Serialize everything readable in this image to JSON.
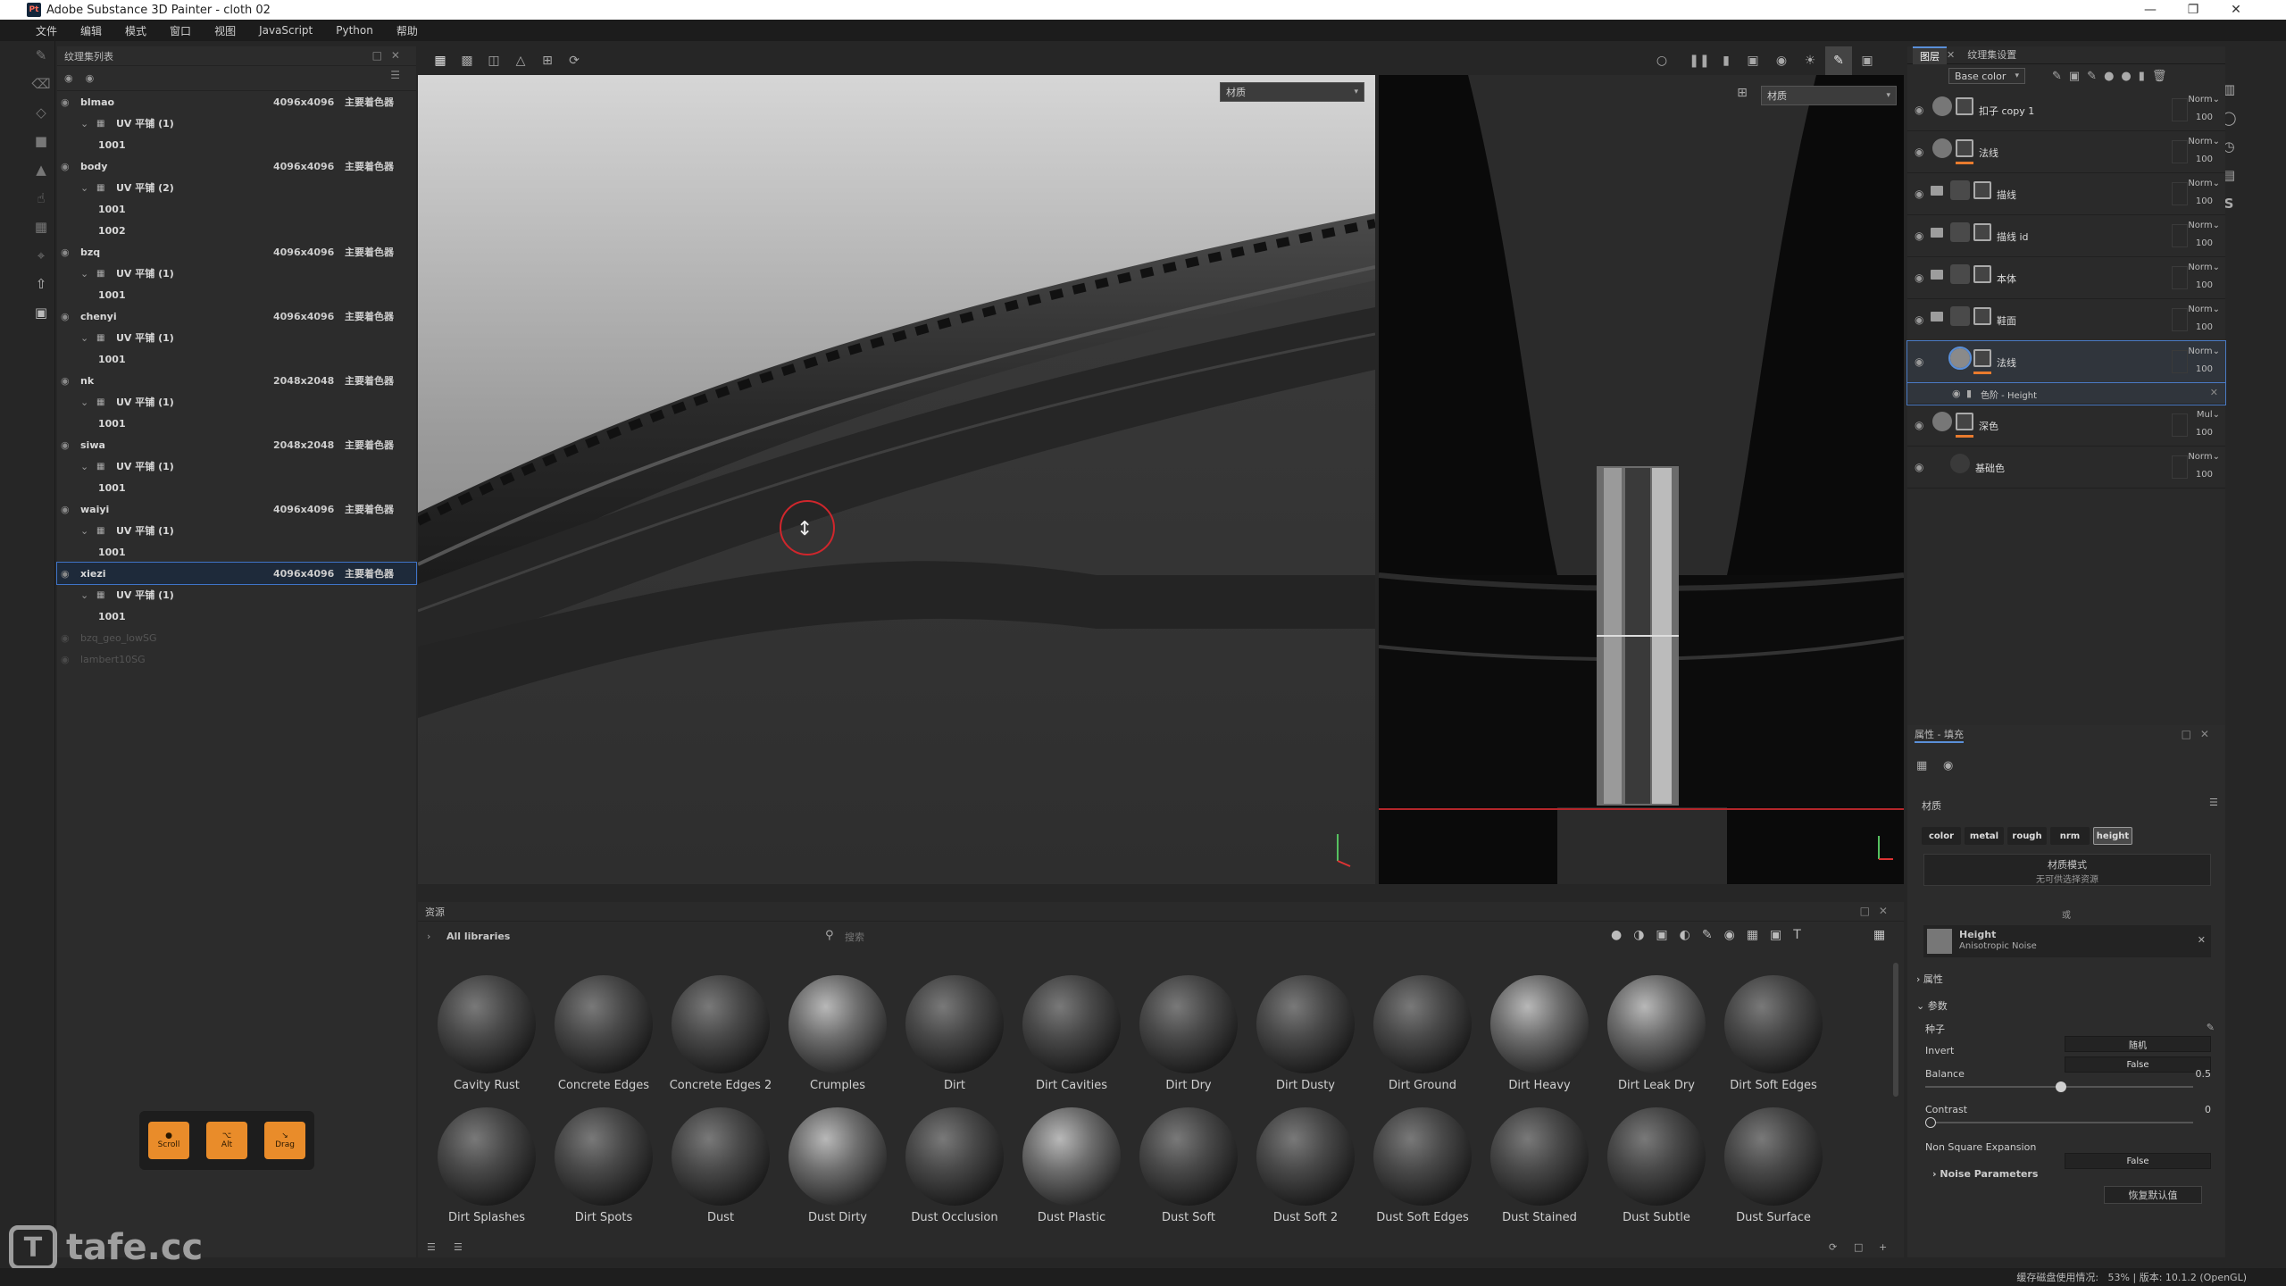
{
  "window": {
    "title": "Adobe Substance 3D Painter - cloth 02",
    "logo": "Pt"
  },
  "menu": [
    "文件",
    "编辑",
    "模式",
    "窗口",
    "视图",
    "JavaScript",
    "Python",
    "帮助"
  ],
  "texture_sets": {
    "title": "纹理集列表",
    "rows": [
      {
        "kind": "top",
        "name": "blmao",
        "size": "4096x4096",
        "shader": "主要着色器"
      },
      {
        "kind": "uv",
        "name": "UV 平铺 (1)"
      },
      {
        "kind": "tile",
        "name": "1001"
      },
      {
        "kind": "top",
        "name": "body",
        "size": "4096x4096",
        "shader": "主要着色器"
      },
      {
        "kind": "uv",
        "name": "UV 平铺 (2)"
      },
      {
        "kind": "tile",
        "name": "1001"
      },
      {
        "kind": "tile",
        "name": "1002"
      },
      {
        "kind": "top",
        "name": "bzq",
        "size": "4096x4096",
        "shader": "主要着色器"
      },
      {
        "kind": "uv",
        "name": "UV 平铺 (1)"
      },
      {
        "kind": "tile",
        "name": "1001"
      },
      {
        "kind": "top",
        "name": "chenyi",
        "size": "4096x4096",
        "shader": "主要着色器"
      },
      {
        "kind": "uv",
        "name": "UV 平铺 (1)"
      },
      {
        "kind": "tile",
        "name": "1001"
      },
      {
        "kind": "top",
        "name": "nk",
        "size": "2048x2048",
        "shader": "主要着色器"
      },
      {
        "kind": "uv",
        "name": "UV 平铺 (1)"
      },
      {
        "kind": "tile",
        "name": "1001"
      },
      {
        "kind": "top",
        "name": "siwa",
        "size": "2048x2048",
        "shader": "主要着色器"
      },
      {
        "kind": "uv",
        "name": "UV 平铺 (1)"
      },
      {
        "kind": "tile",
        "name": "1001"
      },
      {
        "kind": "top",
        "name": "waiyi",
        "size": "4096x4096",
        "shader": "主要着色器"
      },
      {
        "kind": "uv",
        "name": "UV 平铺 (1)"
      },
      {
        "kind": "tile",
        "name": "1001"
      },
      {
        "kind": "top",
        "name": "xiezi",
        "size": "4096x4096",
        "shader": "主要着色器",
        "selected": true
      },
      {
        "kind": "uv",
        "name": "UV 平铺 (1)"
      },
      {
        "kind": "tile",
        "name": "1001"
      },
      {
        "kind": "dim",
        "name": "bzq_geo_lowSG"
      },
      {
        "kind": "dim",
        "name": "lambert10SG"
      }
    ]
  },
  "viewport": {
    "dropdown3d": "材质",
    "dropdown2d": "材质"
  },
  "layers_panel": {
    "tabs": [
      "图层",
      "纹理集设置"
    ],
    "channel": "Base color",
    "layers": [
      {
        "name": "扣子 copy 1",
        "blend": "Norm",
        "opacity": "100",
        "type": "fill",
        "orange": false
      },
      {
        "name": "法线",
        "blend": "Norm",
        "opacity": "100",
        "type": "fill",
        "orange": true
      },
      {
        "name": "描线",
        "blend": "Norm",
        "opacity": "100",
        "type": "folder",
        "orange": false
      },
      {
        "name": "描线 id",
        "blend": "Norm",
        "opacity": "100",
        "type": "folder",
        "orange": false
      },
      {
        "name": "本体",
        "blend": "Norm",
        "opacity": "100",
        "type": "folder",
        "orange": false
      },
      {
        "name": "鞋面",
        "blend": "Norm",
        "opacity": "100",
        "type": "folder",
        "orange": false
      },
      {
        "name": "法线",
        "blend": "Norm",
        "opacity": "100",
        "type": "fill-sel",
        "orange": true,
        "selected": true
      },
      {
        "name": "深色",
        "blend": "Mul",
        "opacity": "100",
        "type": "fill",
        "orange": true
      },
      {
        "name": "基础色",
        "blend": "Norm",
        "opacity": "100",
        "type": "plain",
        "orange": false
      }
    ],
    "effect": "色阶 - Height"
  },
  "properties": {
    "title": "属性 - 填充",
    "section": "材质",
    "channels": [
      "color",
      "metal",
      "rough",
      "nrm",
      "height"
    ],
    "mode": "材质模式",
    "mode_sub": "无可供选择资源",
    "divider": "或",
    "resource_name": "Height",
    "resource_sub": "Anisotropic Noise",
    "group_attrs": "属性",
    "group_params": "参数",
    "params": [
      {
        "label": "种子",
        "value": "随机"
      },
      {
        "label": "Invert",
        "value": "False"
      }
    ],
    "balance_label": "Balance",
    "balance_value": "0.5",
    "contrast_label": "Contrast",
    "contrast_value": "0",
    "nse_label": "Non Square Expansion",
    "nse_value": "False",
    "noise": "Noise Parameters",
    "reset": "恢复默认值"
  },
  "assets": {
    "title": "资源",
    "crumb": "All libraries",
    "search_placeholder": "搜索",
    "items": [
      "Cavity Rust",
      "Concrete Edges",
      "Concrete Edges 2",
      "Crumples",
      "Dirt",
      "Dirt Cavities",
      "Dirt Dry",
      "Dirt Dusty",
      "Dirt Ground",
      "Dirt Heavy",
      "Dirt Leak Dry",
      "Dirt Soft Edges",
      "Dirt Splashes",
      "Dirt Spots",
      "Dust",
      "Dust Dirty",
      "Dust Occlusion",
      "Dust Plastic",
      "Dust Soft",
      "Dust Soft 2",
      "Dust Soft Edges",
      "Dust Stained",
      "Dust Subtle",
      "Dust Surface"
    ]
  },
  "hud": [
    "Scroll",
    "Alt",
    "Drag"
  ],
  "status": {
    "text": "缓存磁盘使用情况:",
    "value": "53% | 版本: 10.1.2 (OpenGL)"
  },
  "watermark": "tafe.cc"
}
